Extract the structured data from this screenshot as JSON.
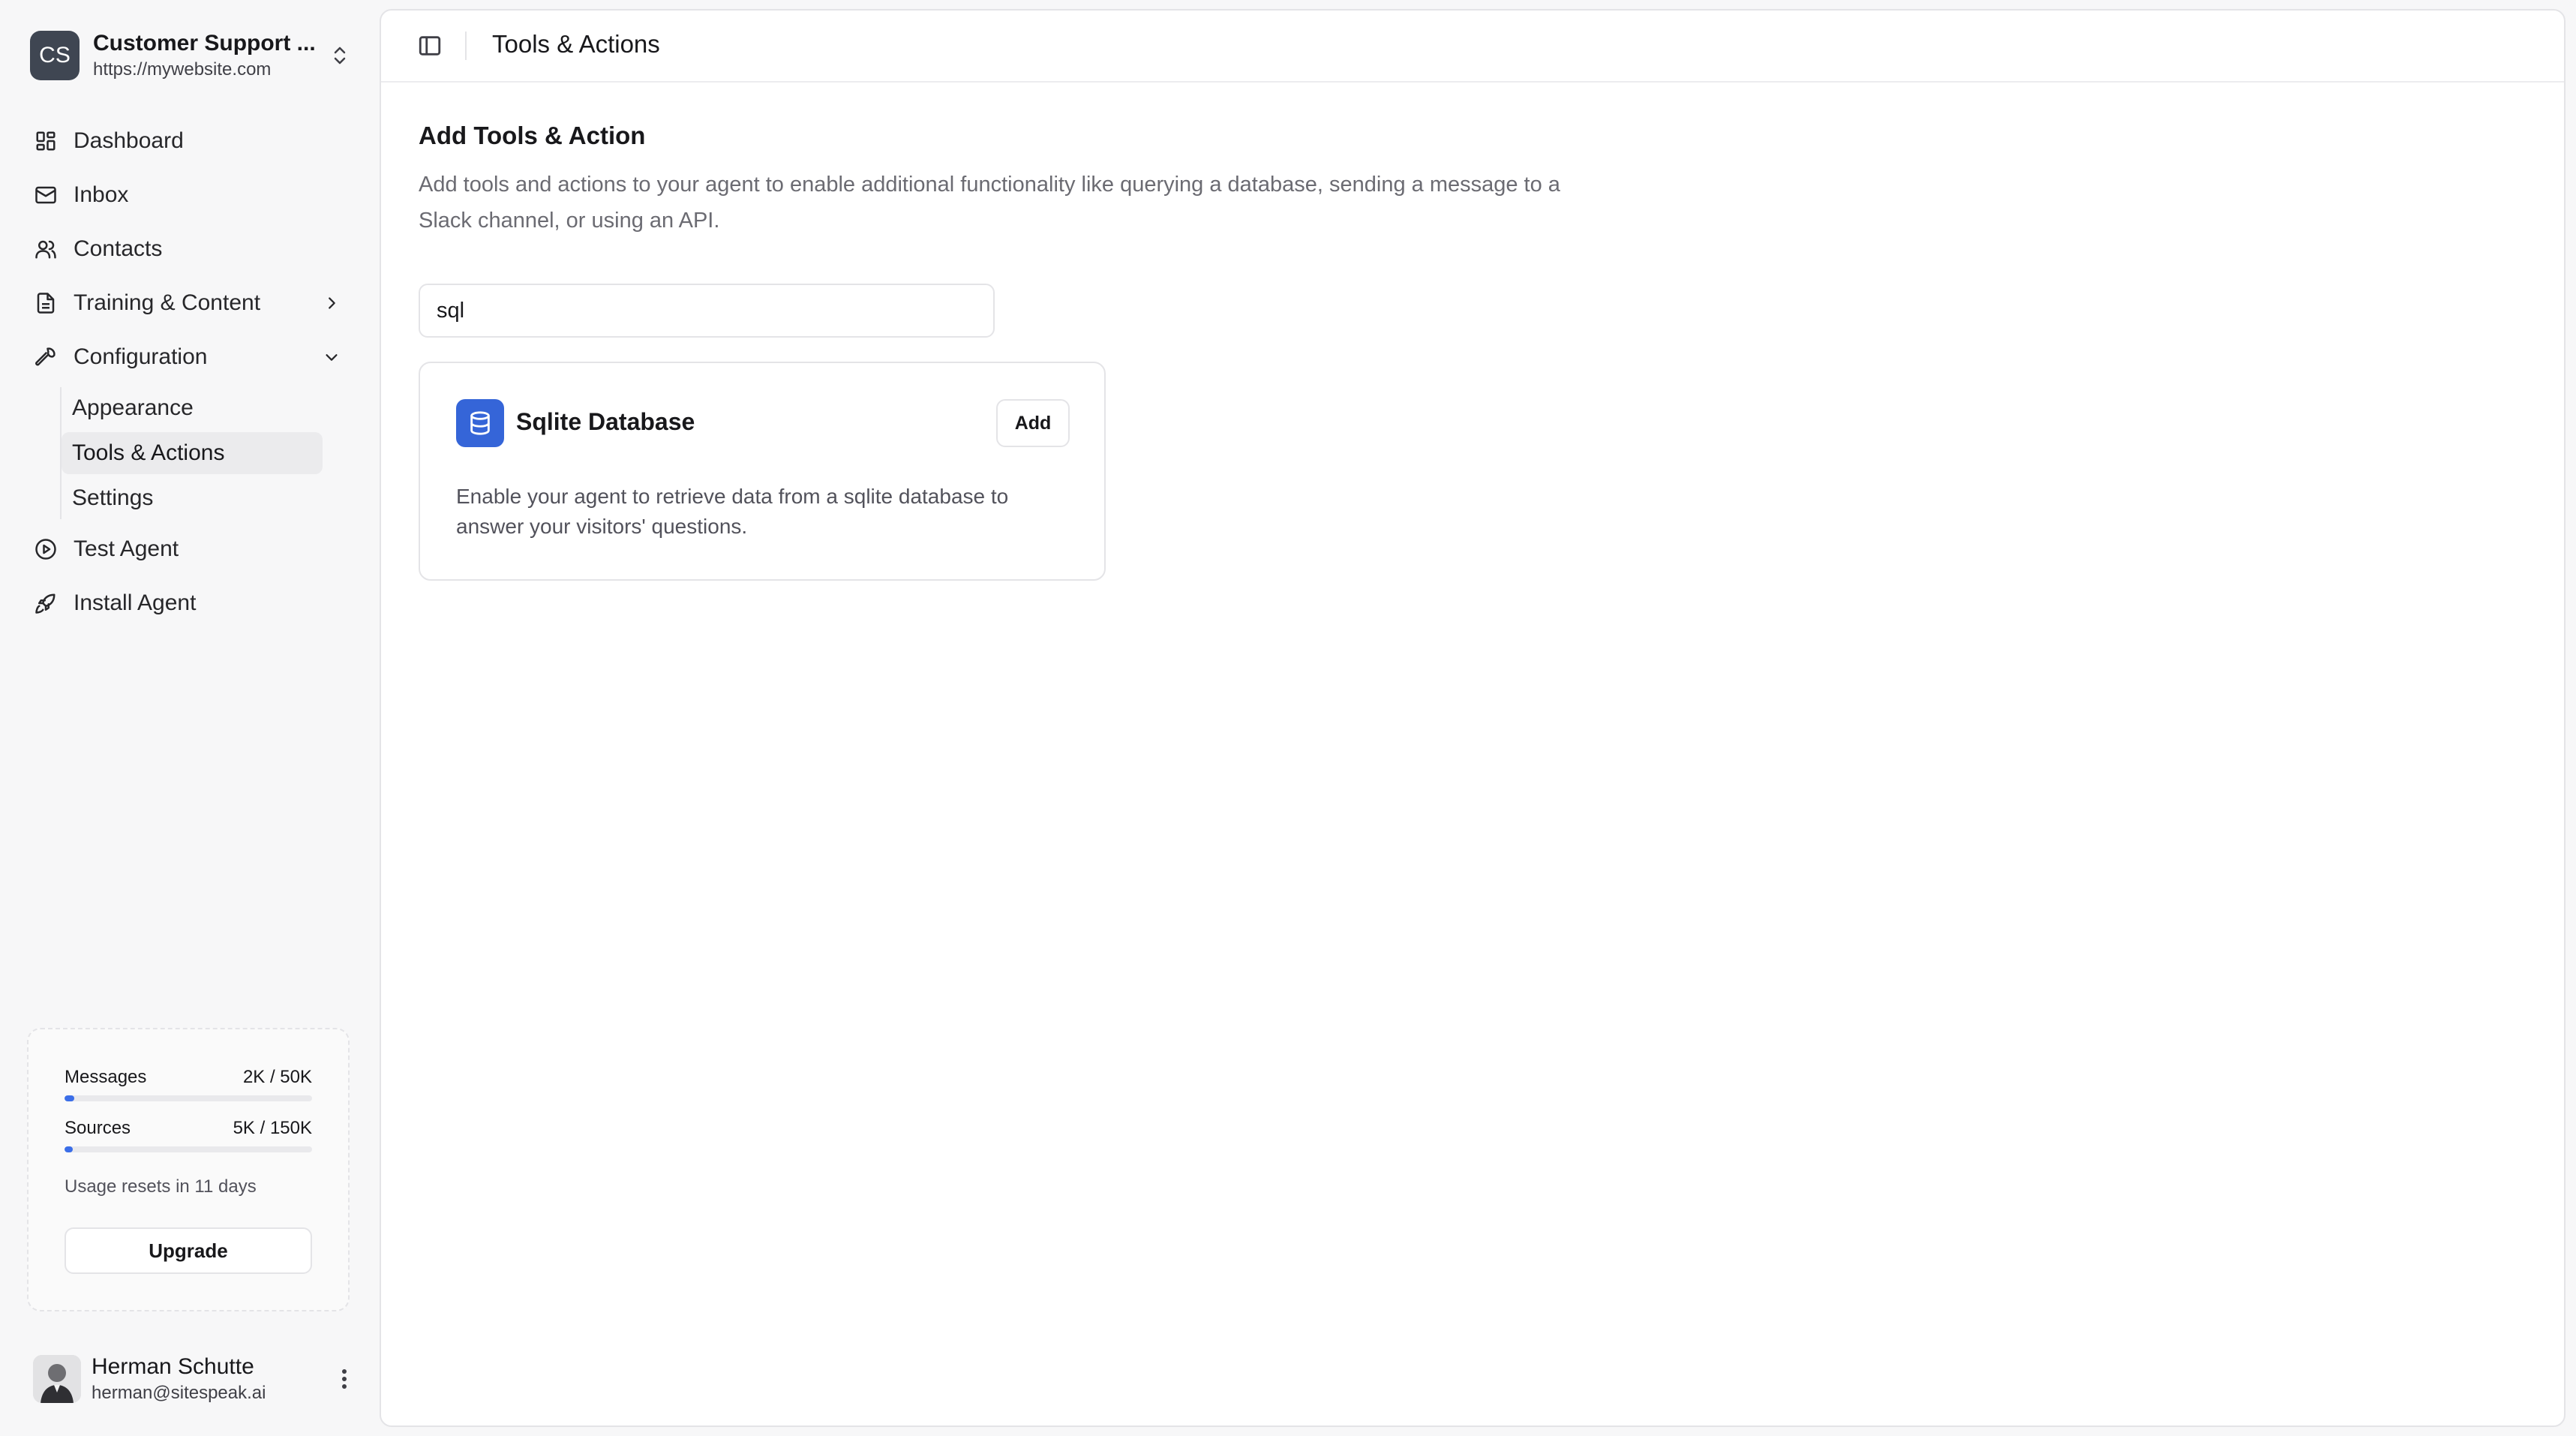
{
  "workspace": {
    "initials": "CS",
    "name": "Customer Support ...",
    "url": "https://mywebsite.com"
  },
  "nav": {
    "dashboard": "Dashboard",
    "inbox": "Inbox",
    "contacts": "Contacts",
    "training": "Training & Content",
    "configuration": "Configuration",
    "config_children": {
      "appearance": "Appearance",
      "tools": "Tools & Actions",
      "settings": "Settings"
    },
    "test_agent": "Test Agent",
    "install_agent": "Install Agent"
  },
  "usage": {
    "messages_label": "Messages",
    "messages_value": "2K / 50K",
    "messages_fraction": 0.04,
    "sources_label": "Sources",
    "sources_value": "5K / 150K",
    "sources_fraction": 0.033,
    "reset_note": "Usage resets in 11 days",
    "upgrade_label": "Upgrade"
  },
  "user": {
    "name": "Herman Schutte",
    "email": "herman@sitespeak.ai"
  },
  "header": {
    "title": "Tools & Actions"
  },
  "main": {
    "section_title": "Add Tools & Action",
    "section_desc": "Add tools and actions to your agent to enable additional functionality like querying a database, sending a message to a Slack channel, or using an API.",
    "search_value": "sql",
    "card": {
      "title": "Sqlite Database",
      "add_label": "Add",
      "description": "Enable your agent to retrieve data from a sqlite database to answer your visitors' questions."
    }
  },
  "colors": {
    "accent": "#3565d8",
    "progress": "#3b6ee8",
    "active_bg": "#ebebed"
  }
}
